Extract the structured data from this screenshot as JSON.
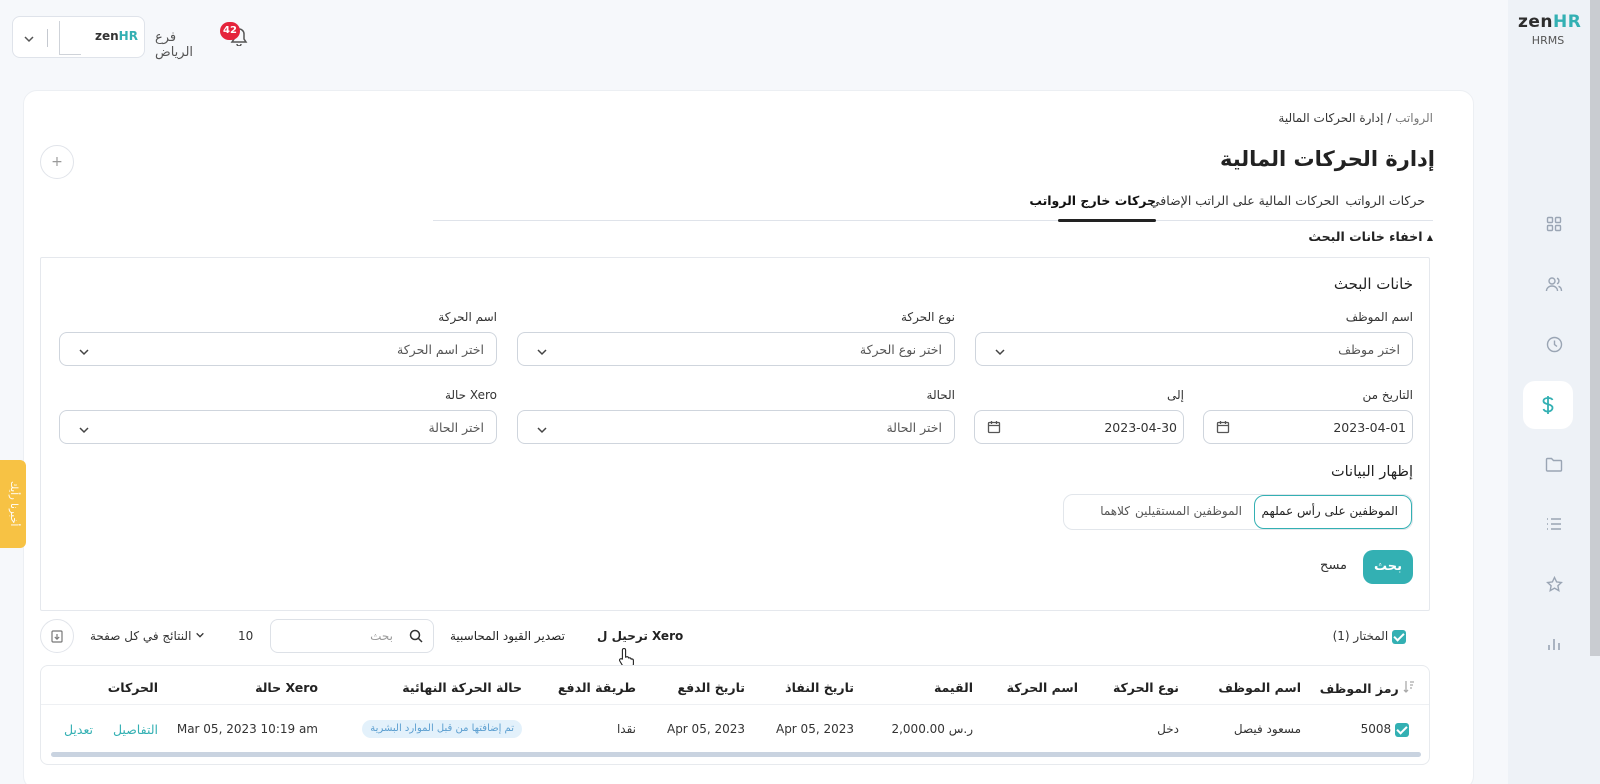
{
  "brand": {
    "name_a": "zen",
    "name_b": "HR",
    "product": "HRMS"
  },
  "topbar": {
    "branch": "فرع الرياض",
    "notifications": "42",
    "logo_a": "zen",
    "logo_b": "HR"
  },
  "breadcrumb": {
    "parent": "الرواتب",
    "sep": " / ",
    "current": "إدارة الحركات المالية"
  },
  "page_title": "إدارة الحركات المالية",
  "add_label": "+",
  "tabs": [
    {
      "label": "حركات الرواتب"
    },
    {
      "label": "الحركات المالية على الراتب الإضافي"
    },
    {
      "label": "حركات خارج الرواتب",
      "active": true
    }
  ],
  "toggle_search": "اخفاء خانات البحث",
  "search_panel": {
    "title": "خانات البحث",
    "employee": {
      "label": "اسم الموظف",
      "placeholder": "اختر موظف"
    },
    "type": {
      "label": "نوع الحركة",
      "placeholder": "اختر نوع الحركة"
    },
    "name": {
      "label": "اسم الحركة",
      "placeholder": "اختر اسم الحركة"
    },
    "date_from": {
      "label": "التاريخ من",
      "value": "2023-04-01"
    },
    "date_to": {
      "label": "إلى",
      "value": "2023-04-30"
    },
    "status": {
      "label": "الحالة",
      "placeholder": "اختر الحالة"
    },
    "xero_status": {
      "label": "حالة Xero",
      "placeholder": "اختر الحالة"
    },
    "display": {
      "label": "إظهار البيانات",
      "options": [
        "الموظفين على رأس عملهم",
        "الموظفين المستقيلين",
        "كلاهما"
      ]
    },
    "search_btn": "بحث",
    "clear_btn": "مسح"
  },
  "toolbar": {
    "selected": "المختار (1)",
    "xero": "ترحيل ل Xero",
    "export_accounting": "تصدير القيود المحاسبية",
    "search_placeholder": "بحث",
    "per_page_value": "10",
    "per_page_label": "النتائج في كل صفحة"
  },
  "table": {
    "headers": [
      "رمز الموظف",
      "اسم الموظف",
      "نوع الحركة",
      "اسم الحركة",
      "القيمة",
      "تاريخ النفاذ",
      "تاريخ الدفع",
      "طريقة الدفع",
      "حالة الحركة النهائية",
      "حالة Xero",
      "الحركات"
    ],
    "rows": [
      {
        "code": "5008",
        "employee": "مسعود فيصل",
        "type": "دخل",
        "name": "",
        "amount": "2,000.00 ر.س",
        "effective": "Apr 05, 2023",
        "paid": "Apr 05, 2023",
        "method": "نقدا",
        "final_status": "تم إضافتها من قبل الموارد البشرية",
        "xero_status": "Mar 05, 2023 10:19 am",
        "details": "التفاصيل",
        "edit": "تعديل"
      }
    ]
  },
  "feedback": "أخبرنا رأيك",
  "colors": {
    "accent": "#33b0b3",
    "badge": "#e5243b",
    "feedback": "#f7c244"
  }
}
